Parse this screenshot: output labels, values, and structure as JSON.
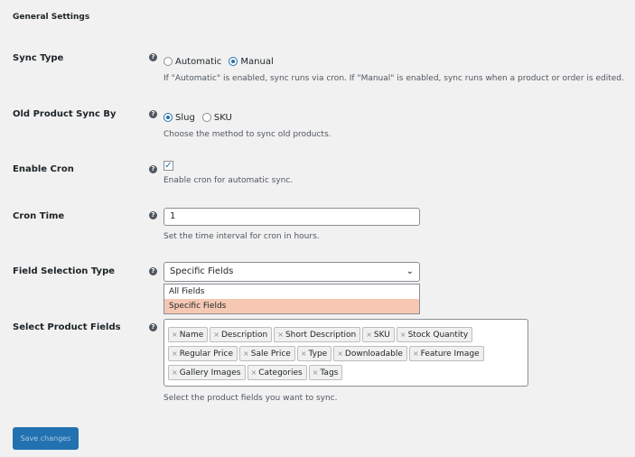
{
  "section_title": "General Settings",
  "sync_type": {
    "label": "Sync Type",
    "options": [
      "Automatic",
      "Manual"
    ],
    "selected": "Manual",
    "description": "If \"Automatic\" is enabled, sync runs via cron. If \"Manual\" is enabled, sync runs when a product or order is edited."
  },
  "old_sync": {
    "label": "Old Product Sync By",
    "options": [
      "Slug",
      "SKU"
    ],
    "selected": "Slug",
    "description": "Choose the method to sync old products."
  },
  "enable_cron": {
    "label": "Enable Cron",
    "checked": true,
    "description": "Enable cron for automatic sync."
  },
  "cron_time": {
    "label": "Cron Time",
    "value": "1",
    "description": "Set the time interval for cron in hours."
  },
  "field_selection": {
    "label": "Field Selection Type",
    "value": "Specific Fields",
    "options": [
      "All Fields",
      "Specific Fields"
    ]
  },
  "product_fields": {
    "label": "Select Product Fields",
    "tags": [
      "Name",
      "Description",
      "Short Description",
      "SKU",
      "Stock Quantity",
      "Regular Price",
      "Sale Price",
      "Type",
      "Downloadable",
      "Feature Image",
      "Gallery Images",
      "Categories",
      "Tags"
    ],
    "description": "Select the product fields you want to sync."
  },
  "save_button": "Save changes",
  "help_icon": "question-circle-icon",
  "colors": {
    "accent": "#2271b1",
    "highlight": "#f6c8b4"
  }
}
